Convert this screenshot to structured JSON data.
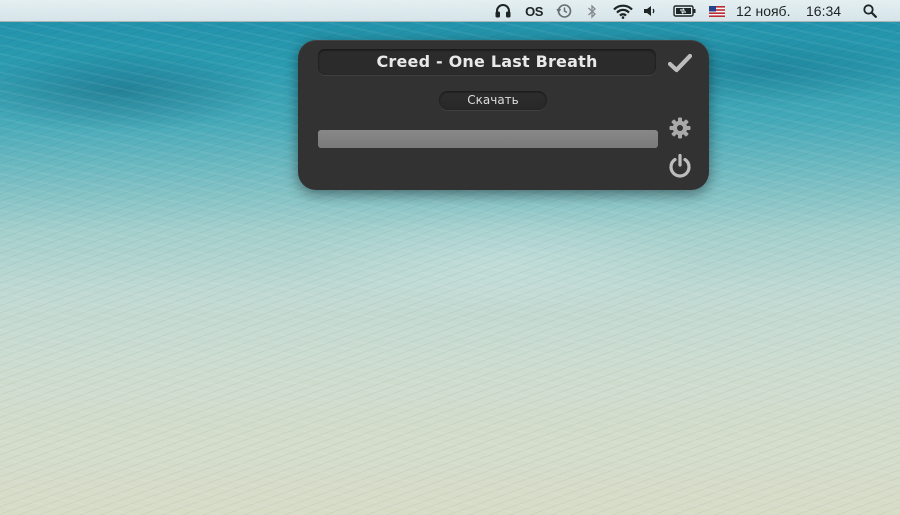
{
  "menubar": {
    "date": "12 нояб.",
    "time": "16:34",
    "icons": [
      "headphones-icon",
      "os-status-icon",
      "time-machine-icon",
      "bluetooth-icon",
      "wifi-icon",
      "volume-icon",
      "battery-icon",
      "us-flag-input-icon",
      "spotlight-search-icon"
    ],
    "os_label": "OS"
  },
  "popup": {
    "track_title": "Creed - One Last Breath",
    "download_label": "Скачать",
    "progress_fraction": 1.0,
    "icons": [
      "checkmark-icon",
      "gear-icon",
      "power-icon"
    ]
  }
}
